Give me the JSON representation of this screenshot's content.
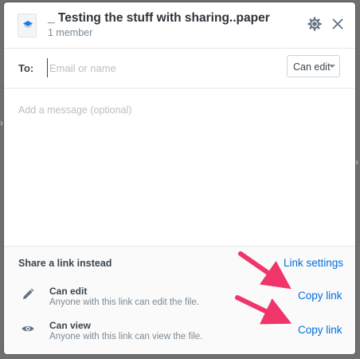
{
  "dialog": {
    "title": "_ Testing the stuff with sharing..paper",
    "member_count": "1 member"
  },
  "to_row": {
    "label": "To:",
    "placeholder": "Email or name",
    "permission_selected": "Can edit"
  },
  "message": {
    "placeholder": "Add a message (optional)"
  },
  "share_link": {
    "title": "Share a link instead",
    "settings_label": "Link settings",
    "rows": [
      {
        "name": "Can edit",
        "description": "Anyone with this link can edit the file.",
        "action_label": "Copy link",
        "icon": "pencil-icon"
      },
      {
        "name": "Can view",
        "description": "Anyone with this link can view the file.",
        "action_label": "Copy link",
        "icon": "eye-icon"
      }
    ]
  },
  "colors": {
    "accent_link": "#0070e0",
    "annotation_arrow": "#f0356b",
    "backdrop": "#6f6f6f"
  }
}
